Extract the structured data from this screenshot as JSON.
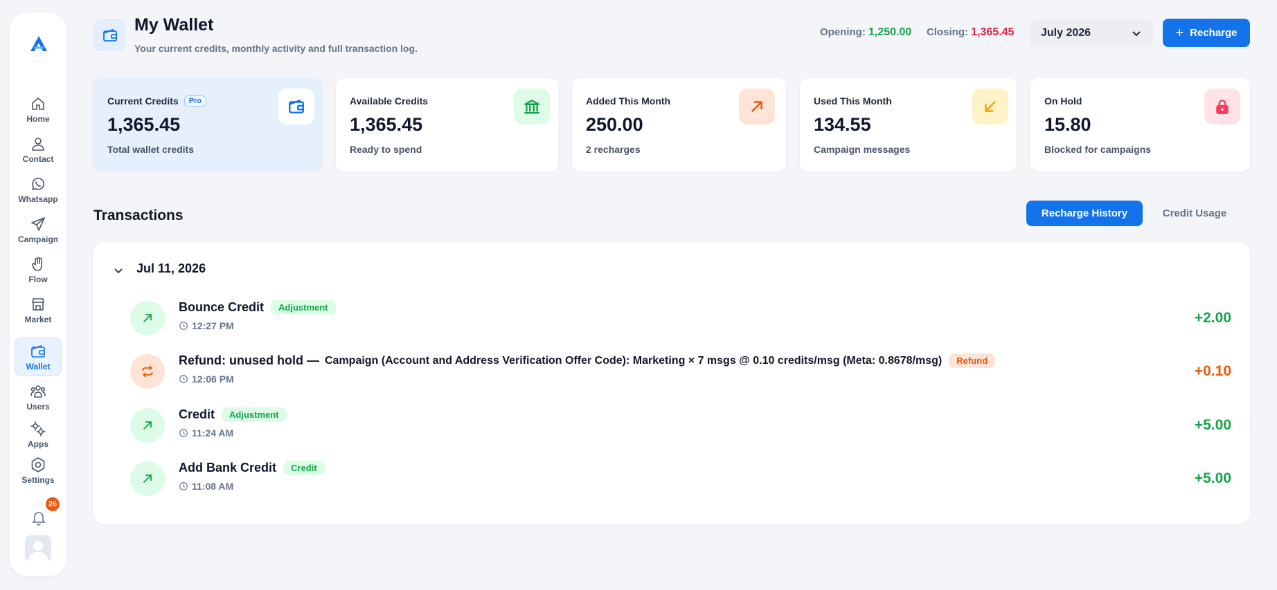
{
  "sidebar": {
    "items": [
      {
        "label": "Home",
        "icon": "home-icon"
      },
      {
        "label": "Contact",
        "icon": "contact-icon"
      },
      {
        "label": "Whatsapp",
        "icon": "whatsapp-icon"
      },
      {
        "label": "Campaign",
        "icon": "campaign-icon"
      },
      {
        "label": "Flow",
        "icon": "flow-icon"
      },
      {
        "label": "Market",
        "icon": "market-icon"
      },
      {
        "label": "Wallet",
        "icon": "wallet-icon",
        "active": true
      },
      {
        "label": "Users",
        "icon": "users-icon"
      },
      {
        "label": "Apps",
        "icon": "apps-icon"
      },
      {
        "label": "Settings",
        "icon": "settings-icon"
      }
    ],
    "notification_count": "26"
  },
  "header": {
    "title": "My Wallet",
    "subtitle": "Your current credits, monthly activity and full transaction log.",
    "opening_label": "Opening:",
    "opening_value": "1,250.00",
    "closing_label": "Closing:",
    "closing_value": "1,365.45",
    "month": "July 2026",
    "recharge_label": "Recharge"
  },
  "cards": [
    {
      "label": "Current Credits",
      "badge": "Pro",
      "value": "1,365.45",
      "sub": "Total wallet credits",
      "icon": "wallet-icon"
    },
    {
      "label": "Available Credits",
      "value": "1,365.45",
      "sub": "Ready to spend",
      "icon": "bank-icon"
    },
    {
      "label": "Added This Month",
      "value": "250.00",
      "sub": "2 recharges",
      "icon": "arrow-up-right-icon"
    },
    {
      "label": "Used This Month",
      "value": "134.55",
      "sub": "Campaign messages",
      "icon": "arrow-down-left-icon"
    },
    {
      "label": "On Hold",
      "value": "15.80",
      "sub": "Blocked for campaigns",
      "icon": "lock-icon"
    }
  ],
  "colors": {
    "accent": "#1273eb",
    "positive": "#16a34a",
    "negative": "#e11d48",
    "refund": "#ea580c"
  },
  "transactions": {
    "title": "Transactions",
    "tabs": [
      "Recharge History",
      "Credit Usage"
    ],
    "group_date": "Jul 11, 2026",
    "rows": [
      {
        "name": "Bounce Credit",
        "detail": "",
        "tag": "Adjustment",
        "time": "12:27 PM",
        "amount": "+2.00",
        "icon": "arrow-up-right-icon"
      },
      {
        "name": "Refund: unused hold —",
        "detail": "Campaign (Account and Address Verification Offer Code): Marketing × 7 msgs @ 0.10 credits/msg (Meta: 0.8678/msg)",
        "tag": "Refund",
        "time": "12:06 PM",
        "amount": "+0.10",
        "icon": "refresh-icon"
      },
      {
        "name": "Credit",
        "detail": "",
        "tag": "Adjustment",
        "time": "11:24 AM",
        "amount": "+5.00",
        "icon": "arrow-up-right-icon"
      },
      {
        "name": "Add Bank Credit",
        "detail": "",
        "tag": "Credit",
        "time": "11:08 AM",
        "amount": "+5.00",
        "icon": "arrow-up-right-icon"
      }
    ]
  }
}
